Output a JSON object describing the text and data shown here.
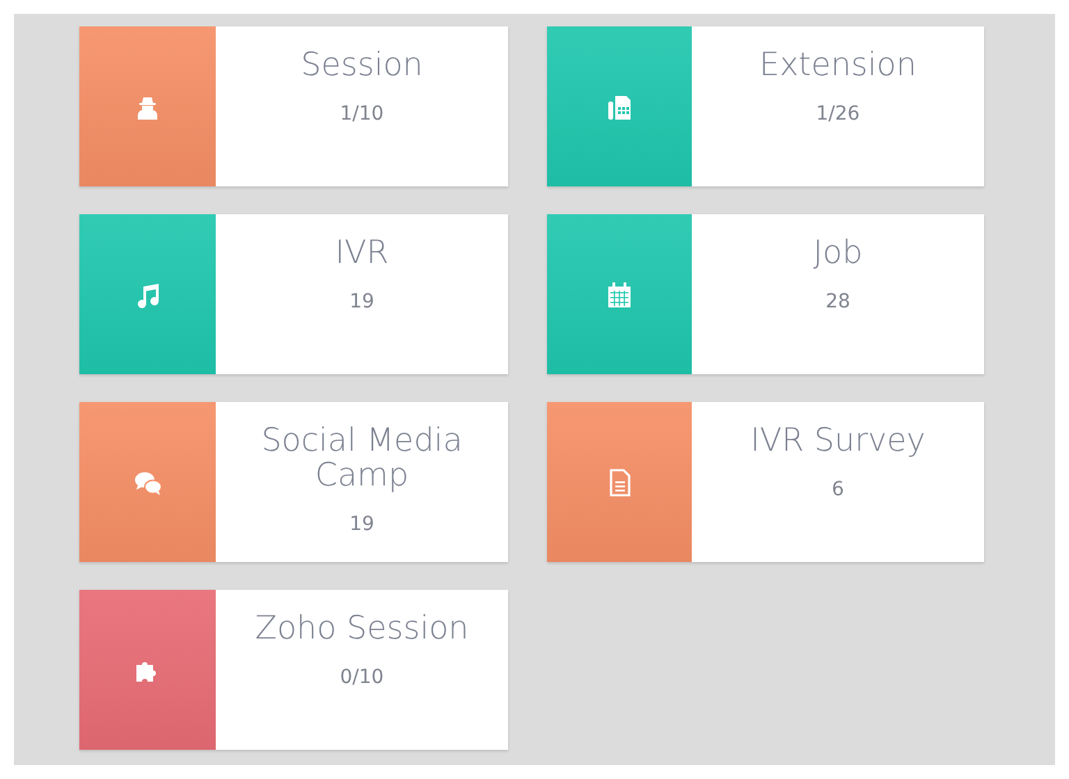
{
  "tiles": [
    {
      "kind": "spy",
      "color": "#f58f66",
      "title": "Session",
      "count": "1/10"
    },
    {
      "kind": "fax",
      "color": "#20c7ae",
      "title": "Extension",
      "count": "1/26"
    },
    {
      "kind": "music",
      "color": "#20c7ae",
      "title": "IVR",
      "count": "19"
    },
    {
      "kind": "calendar",
      "color": "#20c7ae",
      "title": "Job",
      "count": "28"
    },
    {
      "kind": "chat",
      "color": "#f58f66",
      "title": "Social Media Camp",
      "count": "19"
    },
    {
      "kind": "document",
      "color": "#f58f66",
      "title": "IVR Survey",
      "count": "6"
    },
    {
      "kind": "puzzle",
      "color": "#e86c75",
      "title": "Zoho Session",
      "count": "0/10"
    }
  ]
}
